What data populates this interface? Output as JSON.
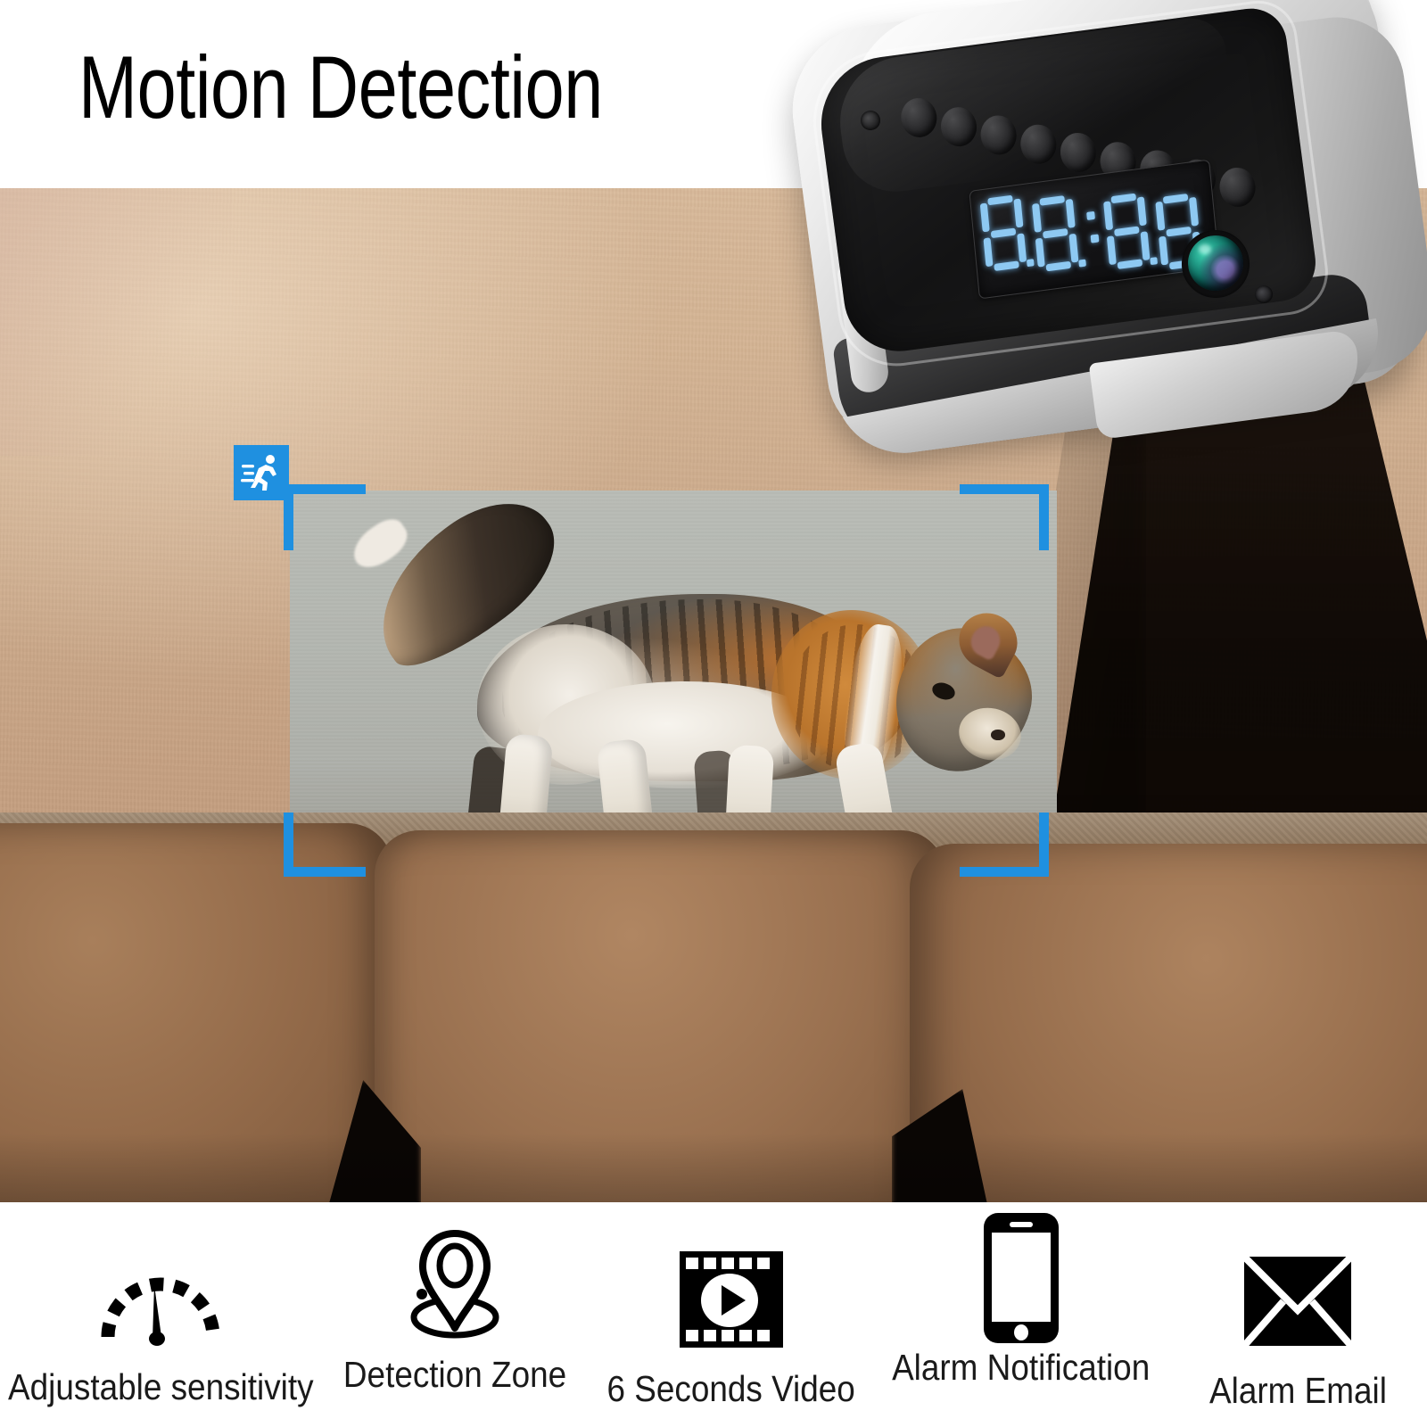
{
  "header": {
    "title": "Motion Detection"
  },
  "scene": {
    "detection_badge_icon": "running-man-icon",
    "detection_brackets": 4,
    "subject": "cat",
    "colors": {
      "bracket_blue": "#1f90e0",
      "badge_blue": "#1f90e0",
      "wall_beige": "#d4b494",
      "couch_brown": "#8e6b4e"
    }
  },
  "device": {
    "name": "hidden-camera-alarm-clock",
    "display_value": "88:88",
    "digits": [
      "8",
      "8",
      "8",
      "8"
    ],
    "ir_led_count": 9,
    "colors": {
      "led_blue": "#8ec9f2",
      "lens_teal": "#23a08a",
      "body_silver": "#d2d2d2",
      "face_black": "#161617"
    }
  },
  "features": [
    {
      "icon": "gauge-icon",
      "label": "Adjustable sensitivity"
    },
    {
      "icon": "location-pin-icon",
      "label": "Detection Zone"
    },
    {
      "icon": "film-play-icon",
      "label": "6 Seconds Video"
    },
    {
      "icon": "smartphone-icon",
      "label": "Alarm Notification"
    },
    {
      "icon": "envelope-icon",
      "label": "Alarm Email"
    }
  ]
}
